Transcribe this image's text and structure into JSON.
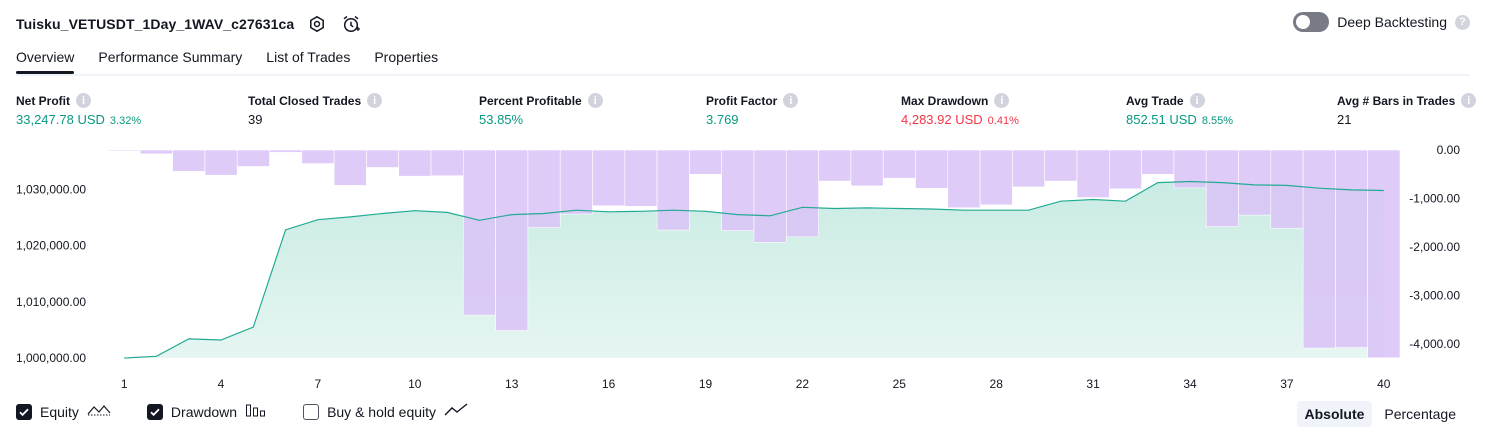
{
  "header": {
    "title": "Tuisku_VETUSDT_1Day_1WAV_c27631ca",
    "settings_icon": "gear-icon",
    "alert_icon": "alarm-clock-icon",
    "deep_backtesting_label": "Deep Backtesting",
    "deep_backtesting_on": false
  },
  "tabs": [
    {
      "label": "Overview",
      "active": true
    },
    {
      "label": "Performance Summary",
      "active": false
    },
    {
      "label": "List of Trades",
      "active": false
    },
    {
      "label": "Properties",
      "active": false
    }
  ],
  "metrics": [
    {
      "label": "Net Profit",
      "value": "33,247.78 USD",
      "pct": "3.32%",
      "color": "#089981"
    },
    {
      "label": "Total Closed Trades",
      "value": "39",
      "pct": "",
      "color": "#131722"
    },
    {
      "label": "Percent Profitable",
      "value": "53.85%",
      "pct": "",
      "color": "#089981"
    },
    {
      "label": "Profit Factor",
      "value": "3.769",
      "pct": "",
      "color": "#089981"
    },
    {
      "label": "Max Drawdown",
      "value": "4,283.92 USD",
      "pct": "0.41%",
      "color": "#f23645"
    },
    {
      "label": "Avg Trade",
      "value": "852.51 USD",
      "pct": "8.55%",
      "color": "#089981"
    },
    {
      "label": "Avg # Bars in Trades",
      "value": "21",
      "pct": "",
      "color": "#131722"
    }
  ],
  "legend": {
    "equity_label": "Equity",
    "drawdown_label": "Drawdown",
    "buyhold_label": "Buy & hold equity",
    "equity_checked": true,
    "drawdown_checked": true,
    "buyhold_checked": false
  },
  "modes": {
    "absolute_label": "Absolute",
    "percentage_label": "Percentage",
    "active": "Absolute"
  },
  "colors": {
    "equity_line": "#22ab94",
    "equity_fill": "#c9ebe3",
    "drawdown_fill": "#d9c2f7",
    "accent": "#089981",
    "loss": "#f23645"
  },
  "chart_data": {
    "type": "area",
    "x": [
      1,
      2,
      3,
      4,
      5,
      6,
      7,
      8,
      9,
      10,
      11,
      12,
      13,
      14,
      15,
      16,
      17,
      18,
      19,
      20,
      21,
      22,
      23,
      24,
      25,
      26,
      27,
      28,
      29,
      30,
      31,
      32,
      33,
      34,
      35,
      36,
      37,
      38,
      39,
      40
    ],
    "x_ticks": [
      "1",
      "4",
      "7",
      "10",
      "13",
      "16",
      "19",
      "22",
      "25",
      "28",
      "31",
      "34",
      "37",
      "40"
    ],
    "series": [
      {
        "name": "Equity",
        "axis": "left",
        "values": [
          1000000,
          1000300,
          1003400,
          1003200,
          1005500,
          1022800,
          1024600,
          1025100,
          1025700,
          1026200,
          1025900,
          1024500,
          1025500,
          1025700,
          1026300,
          1026000,
          1026100,
          1026300,
          1026100,
          1025500,
          1025300,
          1026800,
          1026600,
          1026700,
          1026600,
          1026500,
          1026300,
          1026300,
          1026300,
          1027900,
          1028200,
          1027900,
          1031200,
          1031400,
          1031200,
          1030800,
          1030700,
          1030200,
          1029900,
          1029800
        ]
      },
      {
        "name": "Drawdown",
        "axis": "right",
        "values": [
          -20,
          -80,
          -440,
          -520,
          -340,
          -50,
          -280,
          -730,
          -360,
          -540,
          -530,
          -3400,
          -3720,
          -1600,
          -1320,
          -1150,
          -1160,
          -1650,
          -500,
          -1660,
          -1900,
          -1790,
          -640,
          -740,
          -580,
          -790,
          -1190,
          -1130,
          -760,
          -640,
          -980,
          -800,
          -500,
          -780,
          -1580,
          -1340,
          -1610,
          -4080,
          -4070,
          -4280
        ]
      }
    ],
    "y_left_ticks": [
      "1,000,000.00",
      "1,010,000.00",
      "1,020,000.00",
      "1,030,000.00"
    ],
    "y_left_lim": [
      1000000,
      1037000
    ],
    "y_right_ticks": [
      "0.00",
      "-1,000.00",
      "-2,000.00",
      "-3,000.00",
      "-4,000.00"
    ],
    "y_right_lim": [
      -4283.92,
      0
    ]
  }
}
